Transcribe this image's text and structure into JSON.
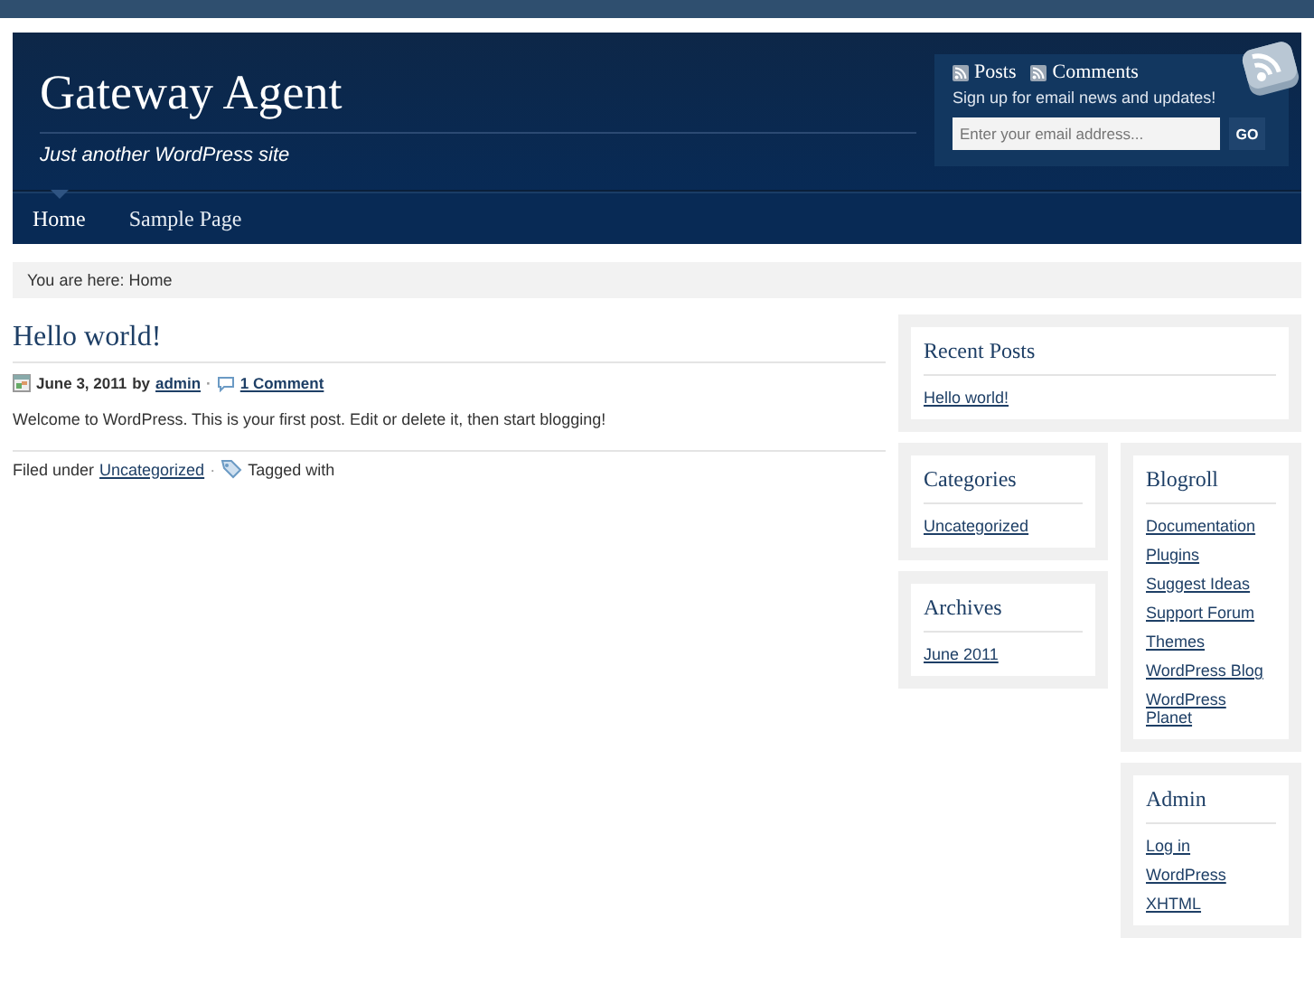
{
  "header": {
    "site_title": "Gateway Agent",
    "tagline": "Just another WordPress site",
    "feeds": [
      "Posts",
      "Comments"
    ],
    "subscribe_text": "Sign up for email news and updates!",
    "email_field": {
      "placeholder": "Enter your email address..."
    },
    "go_button": "GO"
  },
  "nav": [
    {
      "label": "Home",
      "selected": true
    },
    {
      "label": "Sample Page",
      "selected": false
    }
  ],
  "breadcrumb": "You are here: Home",
  "post": {
    "title": "Hello world!",
    "date": "June 3, 2011",
    "by": "by",
    "author": "admin",
    "separator": "·",
    "comments": "1 Comment",
    "body": "Welcome to WordPress. This is your first post. Edit or delete it, then start blogging!",
    "filed_under": "Filed under",
    "category": "Uncategorized",
    "tagged": "Tagged with"
  },
  "sidebar_top": {
    "title": "Recent Posts",
    "links": [
      "Hello world!"
    ]
  },
  "sidebar_left": [
    {
      "title": "Categories",
      "links": [
        "Uncategorized"
      ]
    },
    {
      "title": "Archives",
      "links": [
        "June 2011"
      ]
    }
  ],
  "sidebar_right": [
    {
      "title": "Blogroll",
      "links": [
        "Documentation",
        "Plugins",
        "Suggest Ideas",
        "Support Forum",
        "Themes",
        "WordPress Blog",
        "WordPress Planet"
      ]
    },
    {
      "title": "Admin",
      "links": [
        "Log in",
        "WordPress",
        "XHTML"
      ]
    }
  ]
}
